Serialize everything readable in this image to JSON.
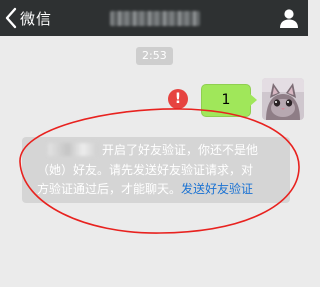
{
  "navbar": {
    "back_label": "微信",
    "bg_color": "#2e3132",
    "icons": {
      "back": "chevron-left-icon",
      "profile": "person-icon"
    }
  },
  "chat": {
    "timestamp": "2:53",
    "message": {
      "text": "1",
      "bubble_color": "#a0e75a",
      "status_icon": "exclamation-error-icon",
      "status_symbol": "!"
    }
  },
  "notice": {
    "line1": "开启了好友验证，你还不是他",
    "line2": "（她）好友。请先发送好友验证请求，对",
    "line3_prefix": "方验证通过后，才能聊天。",
    "link_text": "发送好友验证",
    "link_color": "#1c73d3"
  },
  "annotation": {
    "shape": "ellipse",
    "color": "#e8221f"
  }
}
